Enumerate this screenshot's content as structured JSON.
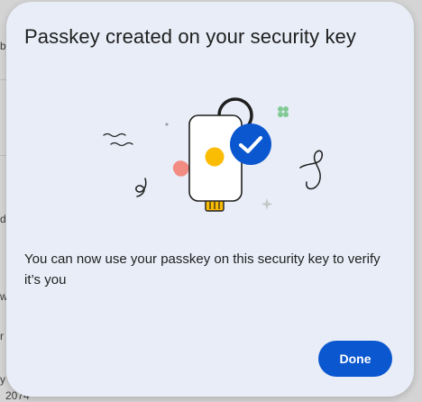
{
  "dialog": {
    "title": "Passkey created on your security key",
    "message": "You can now use your passkey on this security key to verify it’s you",
    "done_label": "Done"
  },
  "background": {
    "fragments": [
      "b",
      "d",
      "w",
      "r",
      "y",
      "2074"
    ]
  },
  "illustration": {
    "icon": "security-key-checkmark-illustration",
    "colors": {
      "key_body": "#ffffff",
      "outline": "#1f1f1f",
      "dot": "#fbbc04",
      "check_badge": "#0b57d0",
      "accent_red": "#f28b82",
      "accent_green": "#81c995"
    }
  },
  "colors": {
    "dialog_background": "#e8edf7",
    "primary": "#0b57d0",
    "text": "#1f1f1f"
  }
}
